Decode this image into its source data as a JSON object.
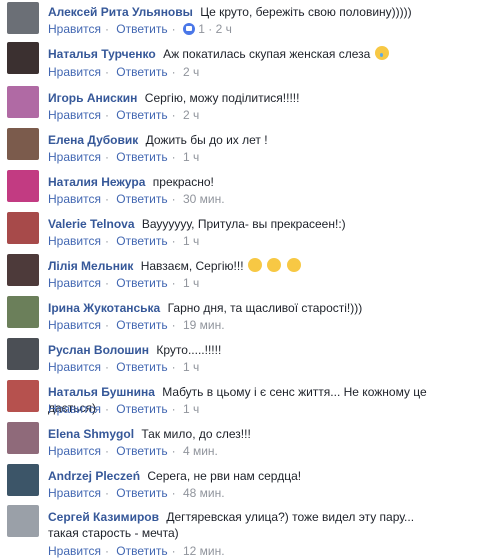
{
  "labels": {
    "like": "Нравится",
    "reply": "Ответить",
    "sep": "·"
  },
  "comments": [
    {
      "author": "Алексей Рита Ульяновы",
      "text": "Це круто, бережіть свою половину)))))",
      "time": "1 · 2 ч",
      "likes": "1",
      "av": "#6b6f76"
    },
    {
      "author": "Наталья Турченко",
      "text": "Аж покатилась скупая женская слеза",
      "time": "2 ч",
      "av": "#3b3030"
    },
    {
      "author": "Игорь Анискин",
      "text": "Сергію, можу поділитися!!!!!",
      "time": "2 ч",
      "av": "#b06aa4"
    },
    {
      "author": "Елена Дубовик",
      "text": "Дожить бы до их лет !",
      "time": "1 ч",
      "av": "#7b5b4c"
    },
    {
      "author": "Наталия Нежура",
      "text": "прекрасно!",
      "time": "30 мин.",
      "av": "#c23b82"
    },
    {
      "author": "Valerie Telnova",
      "text": "Вауууууу, Притула- вы прекрасеен!:)",
      "time": "1 ч",
      "av": "#a74a4a"
    },
    {
      "author": "Лілія Мельник",
      "text": "Навзаєм, Сергію!!!",
      "time": "1 ч",
      "av": "#4d3a3a"
    },
    {
      "author": "Ірина Жукотанська",
      "text": "Гарно дня, та щасливої старості!)))",
      "time": "19 мин.",
      "av": "#6b7f5a"
    },
    {
      "author": "Руслан Волошин",
      "text": "Круто.....!!!!!",
      "time": "1 ч",
      "av": "#4b4f55"
    },
    {
      "author": "Наталья Бушнина",
      "text": "Мабуть в цьому і є сенс життя... Не кожному це дається)",
      "time": "1 ч",
      "av": "#b6514e"
    },
    {
      "author": "Elena Shmygol",
      "text": "Так мило, до слез!!!",
      "time": "4 мин.",
      "av": "#8f6a7a"
    },
    {
      "author": "Andrzej Pleczeń",
      "text": "Серега, не рви нам сердца!",
      "time": "48 мин.",
      "av": "#3c5568"
    },
    {
      "author": "Сергей Казимиров",
      "text": "Дегтяревская улица?) тоже видел эту пару... такая старость - мечта)",
      "time": "12 мин.",
      "av": "#9aa0a8"
    }
  ]
}
